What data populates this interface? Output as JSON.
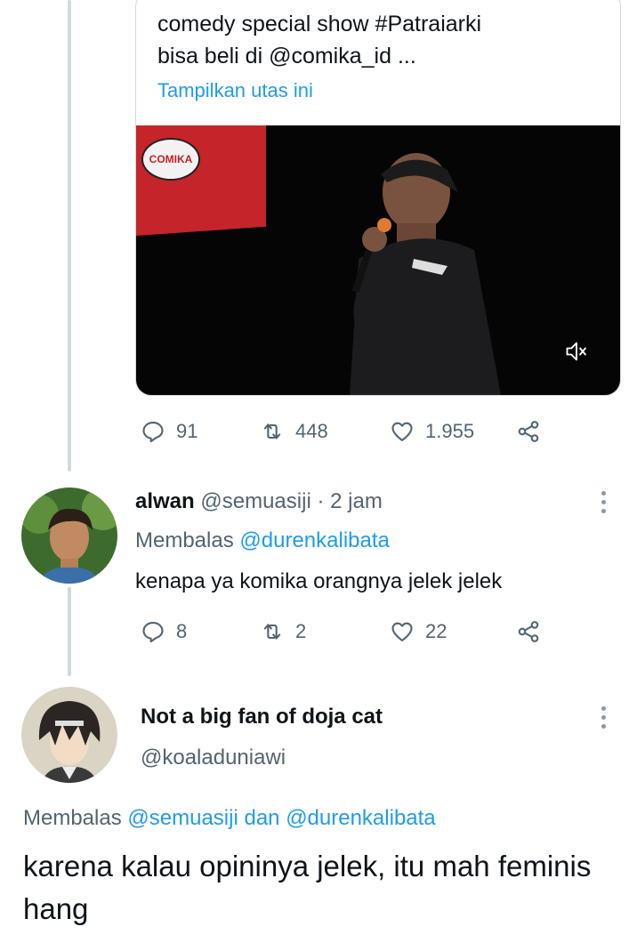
{
  "quoted_tweet": {
    "text_line1": "comedy special show #Patraiarki",
    "text_line2": "bisa beli di @comika_id ...",
    "show_thread_link": "Tampilkan utas ini",
    "video": {
      "badge_text": "COMIKA",
      "mute_icon": "speaker-muted-icon"
    }
  },
  "first_tweet_stats": {
    "replies": "91",
    "retweets": "448",
    "likes": "1.955"
  },
  "reply1": {
    "display_name": "alwan",
    "handle": "@semuasiji",
    "separator": "·",
    "time": "2 jam",
    "replying_prefix": "Membalas",
    "replying_to": "@durenkalibata",
    "text": "kenapa ya komika orangnya jelek jelek",
    "stats": {
      "replies": "8",
      "retweets": "2",
      "likes": "22"
    }
  },
  "reply2": {
    "display_name": "Not a big fan of doja cat",
    "handle": "@koaladuniawi",
    "replying_prefix": "Membalas",
    "replying_to_1": "@semuasiji",
    "conjunction": "dan",
    "replying_to_2": "@durenkalibata",
    "text": "karena kalau opininya jelek, itu mah feminis hang"
  },
  "colors": {
    "accent": "#1d9bf0",
    "muted": "#536471",
    "line": "#cfd9de"
  }
}
